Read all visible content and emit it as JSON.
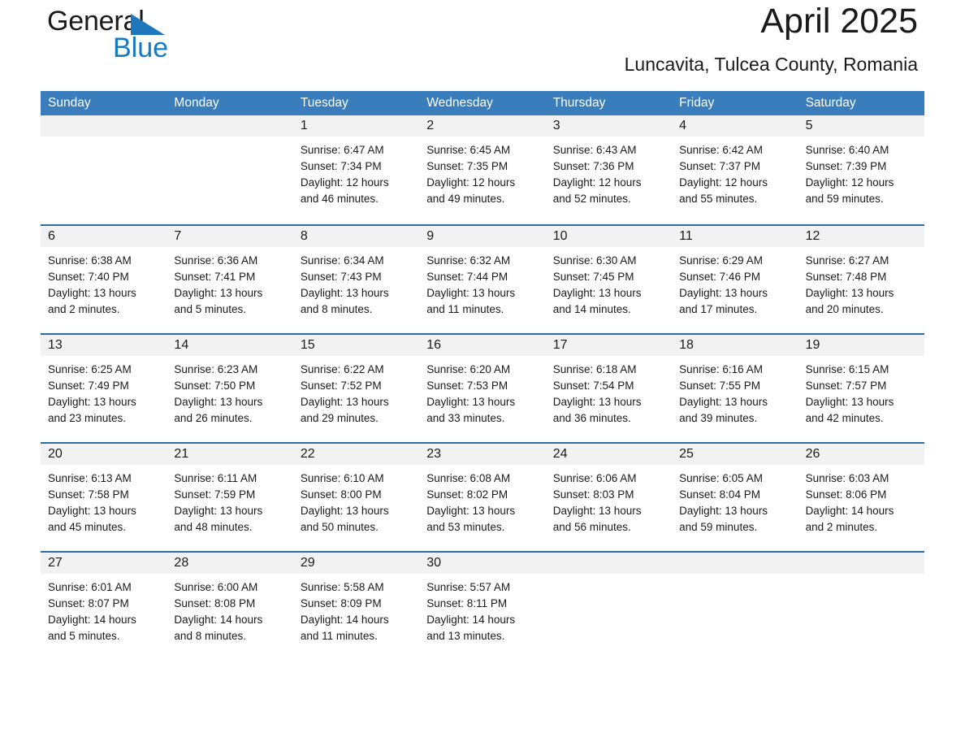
{
  "brand": {
    "name_part1": "General",
    "name_part2": "Blue",
    "accent_color": "#1779c4"
  },
  "header": {
    "title": "April 2025",
    "subtitle": "Luncavita, Tulcea County, Romania"
  },
  "calendar": {
    "header_color": "#3a7dbd",
    "row_border_color": "#2e6da4",
    "daynum_band_color": "#f2f2f2",
    "weekdays": [
      "Sunday",
      "Monday",
      "Tuesday",
      "Wednesday",
      "Thursday",
      "Friday",
      "Saturday"
    ],
    "weeks": [
      [
        {
          "day": ""
        },
        {
          "day": ""
        },
        {
          "day": "1",
          "sunrise": "Sunrise: 6:47 AM",
          "sunset": "Sunset: 7:34 PM",
          "daylight_line1": "Daylight: 12 hours",
          "daylight_line2": "and 46 minutes."
        },
        {
          "day": "2",
          "sunrise": "Sunrise: 6:45 AM",
          "sunset": "Sunset: 7:35 PM",
          "daylight_line1": "Daylight: 12 hours",
          "daylight_line2": "and 49 minutes."
        },
        {
          "day": "3",
          "sunrise": "Sunrise: 6:43 AM",
          "sunset": "Sunset: 7:36 PM",
          "daylight_line1": "Daylight: 12 hours",
          "daylight_line2": "and 52 minutes."
        },
        {
          "day": "4",
          "sunrise": "Sunrise: 6:42 AM",
          "sunset": "Sunset: 7:37 PM",
          "daylight_line1": "Daylight: 12 hours",
          "daylight_line2": "and 55 minutes."
        },
        {
          "day": "5",
          "sunrise": "Sunrise: 6:40 AM",
          "sunset": "Sunset: 7:39 PM",
          "daylight_line1": "Daylight: 12 hours",
          "daylight_line2": "and 59 minutes."
        }
      ],
      [
        {
          "day": "6",
          "sunrise": "Sunrise: 6:38 AM",
          "sunset": "Sunset: 7:40 PM",
          "daylight_line1": "Daylight: 13 hours",
          "daylight_line2": "and 2 minutes."
        },
        {
          "day": "7",
          "sunrise": "Sunrise: 6:36 AM",
          "sunset": "Sunset: 7:41 PM",
          "daylight_line1": "Daylight: 13 hours",
          "daylight_line2": "and 5 minutes."
        },
        {
          "day": "8",
          "sunrise": "Sunrise: 6:34 AM",
          "sunset": "Sunset: 7:43 PM",
          "daylight_line1": "Daylight: 13 hours",
          "daylight_line2": "and 8 minutes."
        },
        {
          "day": "9",
          "sunrise": "Sunrise: 6:32 AM",
          "sunset": "Sunset: 7:44 PM",
          "daylight_line1": "Daylight: 13 hours",
          "daylight_line2": "and 11 minutes."
        },
        {
          "day": "10",
          "sunrise": "Sunrise: 6:30 AM",
          "sunset": "Sunset: 7:45 PM",
          "daylight_line1": "Daylight: 13 hours",
          "daylight_line2": "and 14 minutes."
        },
        {
          "day": "11",
          "sunrise": "Sunrise: 6:29 AM",
          "sunset": "Sunset: 7:46 PM",
          "daylight_line1": "Daylight: 13 hours",
          "daylight_line2": "and 17 minutes."
        },
        {
          "day": "12",
          "sunrise": "Sunrise: 6:27 AM",
          "sunset": "Sunset: 7:48 PM",
          "daylight_line1": "Daylight: 13 hours",
          "daylight_line2": "and 20 minutes."
        }
      ],
      [
        {
          "day": "13",
          "sunrise": "Sunrise: 6:25 AM",
          "sunset": "Sunset: 7:49 PM",
          "daylight_line1": "Daylight: 13 hours",
          "daylight_line2": "and 23 minutes."
        },
        {
          "day": "14",
          "sunrise": "Sunrise: 6:23 AM",
          "sunset": "Sunset: 7:50 PM",
          "daylight_line1": "Daylight: 13 hours",
          "daylight_line2": "and 26 minutes."
        },
        {
          "day": "15",
          "sunrise": "Sunrise: 6:22 AM",
          "sunset": "Sunset: 7:52 PM",
          "daylight_line1": "Daylight: 13 hours",
          "daylight_line2": "and 29 minutes."
        },
        {
          "day": "16",
          "sunrise": "Sunrise: 6:20 AM",
          "sunset": "Sunset: 7:53 PM",
          "daylight_line1": "Daylight: 13 hours",
          "daylight_line2": "and 33 minutes."
        },
        {
          "day": "17",
          "sunrise": "Sunrise: 6:18 AM",
          "sunset": "Sunset: 7:54 PM",
          "daylight_line1": "Daylight: 13 hours",
          "daylight_line2": "and 36 minutes."
        },
        {
          "day": "18",
          "sunrise": "Sunrise: 6:16 AM",
          "sunset": "Sunset: 7:55 PM",
          "daylight_line1": "Daylight: 13 hours",
          "daylight_line2": "and 39 minutes."
        },
        {
          "day": "19",
          "sunrise": "Sunrise: 6:15 AM",
          "sunset": "Sunset: 7:57 PM",
          "daylight_line1": "Daylight: 13 hours",
          "daylight_line2": "and 42 minutes."
        }
      ],
      [
        {
          "day": "20",
          "sunrise": "Sunrise: 6:13 AM",
          "sunset": "Sunset: 7:58 PM",
          "daylight_line1": "Daylight: 13 hours",
          "daylight_line2": "and 45 minutes."
        },
        {
          "day": "21",
          "sunrise": "Sunrise: 6:11 AM",
          "sunset": "Sunset: 7:59 PM",
          "daylight_line1": "Daylight: 13 hours",
          "daylight_line2": "and 48 minutes."
        },
        {
          "day": "22",
          "sunrise": "Sunrise: 6:10 AM",
          "sunset": "Sunset: 8:00 PM",
          "daylight_line1": "Daylight: 13 hours",
          "daylight_line2": "and 50 minutes."
        },
        {
          "day": "23",
          "sunrise": "Sunrise: 6:08 AM",
          "sunset": "Sunset: 8:02 PM",
          "daylight_line1": "Daylight: 13 hours",
          "daylight_line2": "and 53 minutes."
        },
        {
          "day": "24",
          "sunrise": "Sunrise: 6:06 AM",
          "sunset": "Sunset: 8:03 PM",
          "daylight_line1": "Daylight: 13 hours",
          "daylight_line2": "and 56 minutes."
        },
        {
          "day": "25",
          "sunrise": "Sunrise: 6:05 AM",
          "sunset": "Sunset: 8:04 PM",
          "daylight_line1": "Daylight: 13 hours",
          "daylight_line2": "and 59 minutes."
        },
        {
          "day": "26",
          "sunrise": "Sunrise: 6:03 AM",
          "sunset": "Sunset: 8:06 PM",
          "daylight_line1": "Daylight: 14 hours",
          "daylight_line2": "and 2 minutes."
        }
      ],
      [
        {
          "day": "27",
          "sunrise": "Sunrise: 6:01 AM",
          "sunset": "Sunset: 8:07 PM",
          "daylight_line1": "Daylight: 14 hours",
          "daylight_line2": "and 5 minutes."
        },
        {
          "day": "28",
          "sunrise": "Sunrise: 6:00 AM",
          "sunset": "Sunset: 8:08 PM",
          "daylight_line1": "Daylight: 14 hours",
          "daylight_line2": "and 8 minutes."
        },
        {
          "day": "29",
          "sunrise": "Sunrise: 5:58 AM",
          "sunset": "Sunset: 8:09 PM",
          "daylight_line1": "Daylight: 14 hours",
          "daylight_line2": "and 11 minutes."
        },
        {
          "day": "30",
          "sunrise": "Sunrise: 5:57 AM",
          "sunset": "Sunset: 8:11 PM",
          "daylight_line1": "Daylight: 14 hours",
          "daylight_line2": "and 13 minutes."
        },
        {
          "day": ""
        },
        {
          "day": ""
        },
        {
          "day": ""
        }
      ]
    ]
  }
}
